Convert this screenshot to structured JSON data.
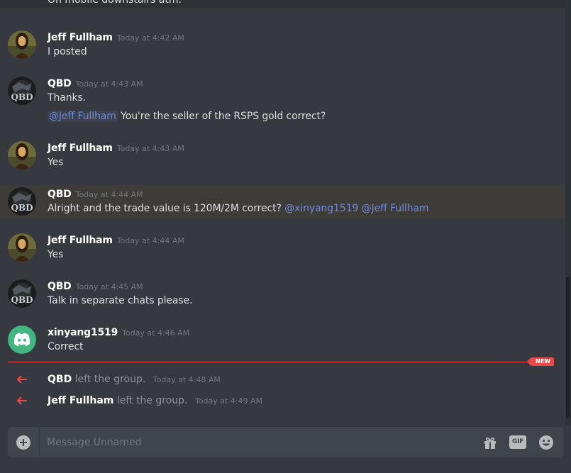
{
  "chat": {
    "partial_top_text": "On mobile downstairs atm.",
    "messages": [
      {
        "author": "Jeff Fullham",
        "timestamp": "Today at 4:42 AM",
        "lines": [
          "I posted"
        ]
      },
      {
        "author": "QBD",
        "timestamp": "Today at 4:43 AM",
        "line1": "Thanks.",
        "mention": "@Jeff Fullham",
        "line2_rest": "You're the seller of the RSPS gold correct?"
      },
      {
        "author": "Jeff Fullham",
        "timestamp": "Today at 4:43 AM",
        "lines": [
          "Yes"
        ]
      },
      {
        "author": "QBD",
        "timestamp": "Today at 4:44 AM",
        "text": "Alright and the trade value is 120M/2M correct?",
        "mention_a": "@xinyang1519",
        "mention_b": "@Jeff Fullham"
      },
      {
        "author": "Jeff Fullham",
        "timestamp": "Today at 4:44 AM",
        "lines": [
          "Yes"
        ]
      },
      {
        "author": "QBD",
        "timestamp": "Today at 4:45 AM",
        "lines": [
          "Talk in separate chats please."
        ]
      },
      {
        "author": "xinyang1519",
        "timestamp": "Today at 4:46 AM",
        "lines": [
          "Correct"
        ]
      }
    ],
    "new_badge": "NEW",
    "system": [
      {
        "name": "QBD",
        "action": "left the group.",
        "timestamp": "Today at 4:48 AM"
      },
      {
        "name": "Jeff Fullham",
        "action": "left the group.",
        "timestamp": "Today at 4:49 AM"
      }
    ]
  },
  "composer": {
    "placeholder": "Message Unnamed",
    "gif_label": "GIF"
  },
  "colors": {
    "background": "#36393f",
    "mention": "#7289da",
    "new_line": "#f04747",
    "discord_green": "#43b581"
  },
  "icons": [
    "mona-lisa-avatar",
    "qbd-avatar",
    "discord-avatar",
    "left-arrow-icon",
    "add-icon",
    "gift-icon",
    "gif-icon",
    "emoji-icon"
  ]
}
